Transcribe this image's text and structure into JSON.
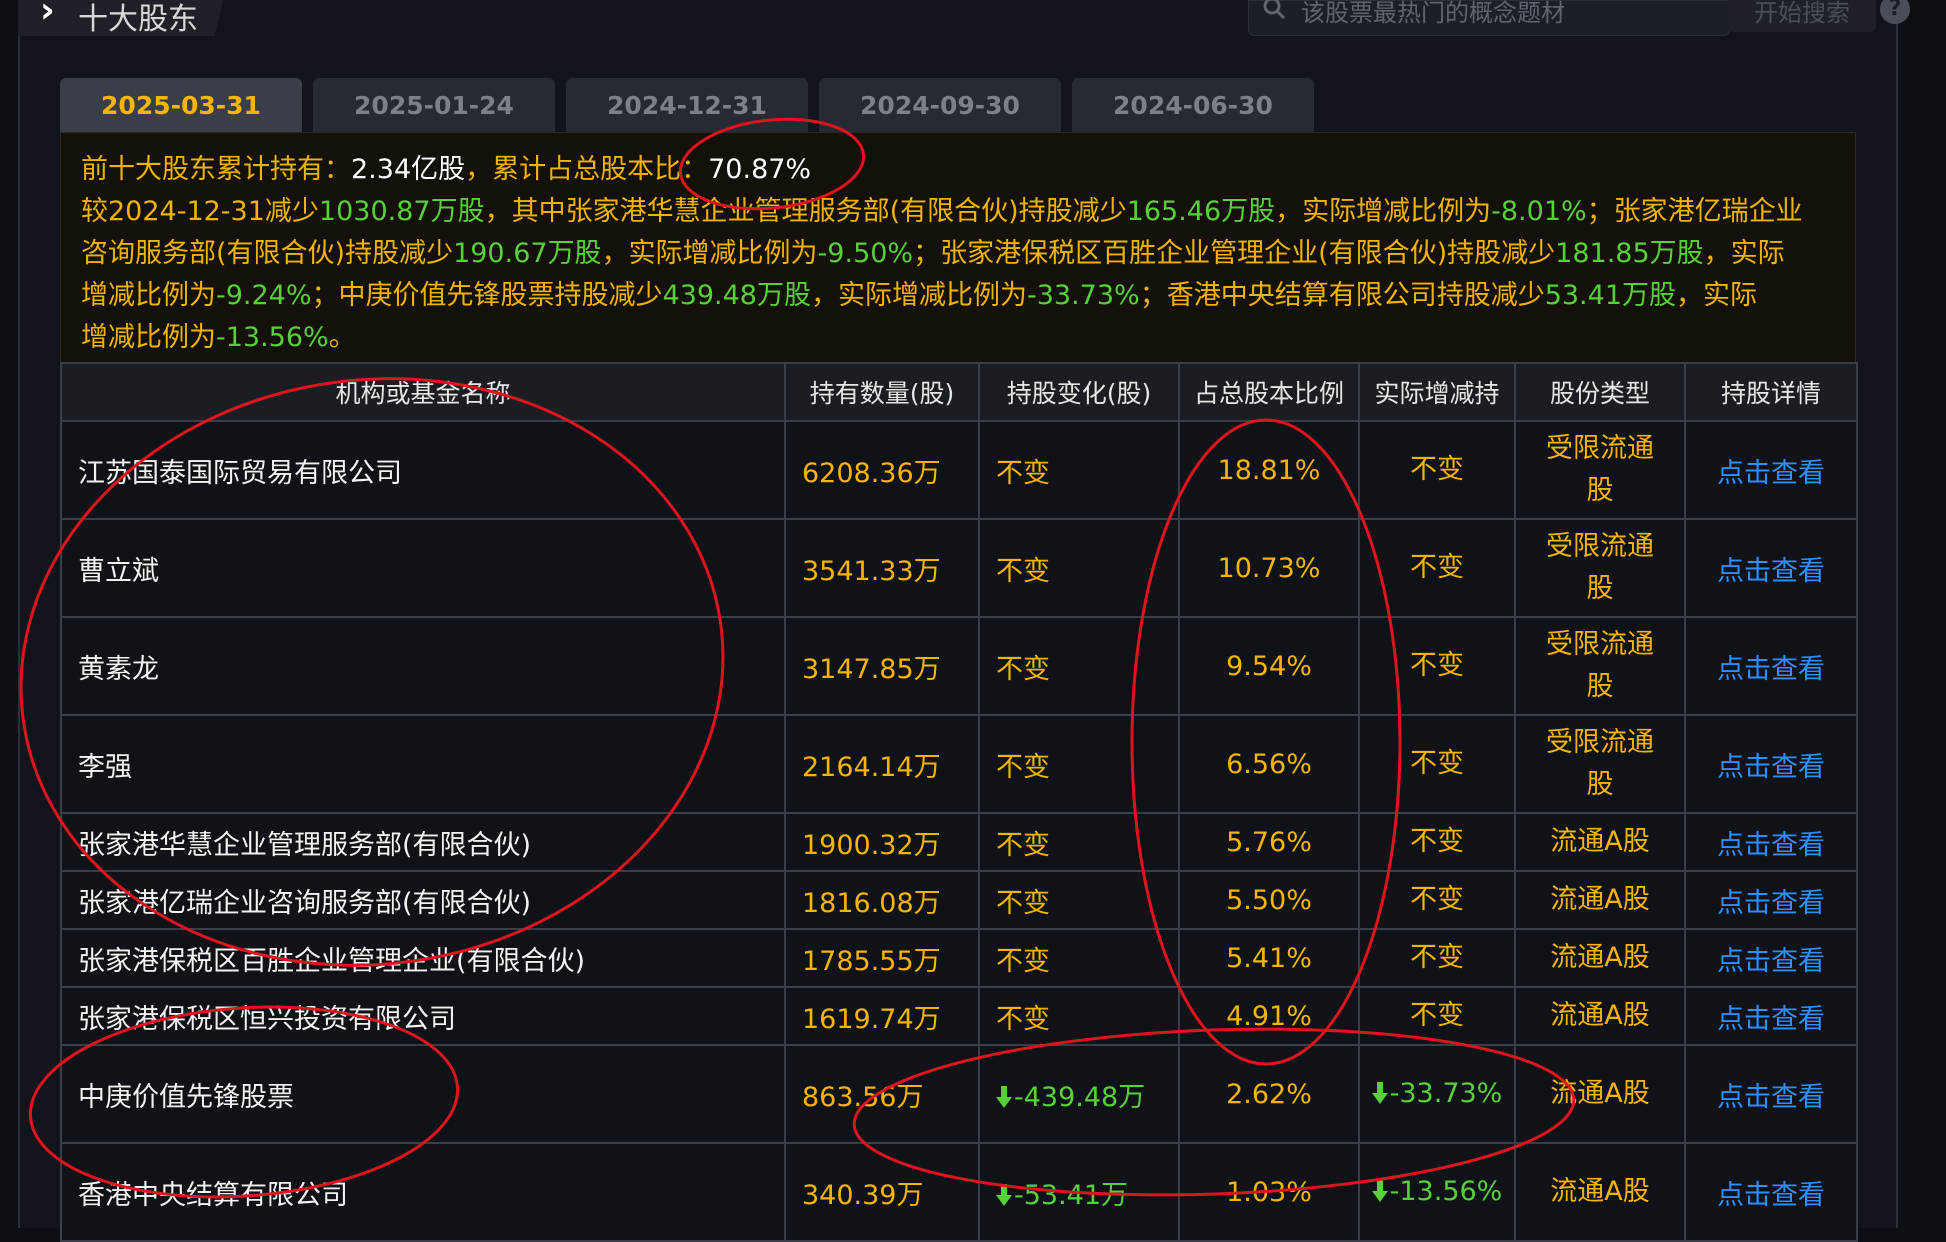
{
  "header": {
    "title": "十大股东",
    "search_placeholder": "该股票最热门的概念题材",
    "search_button": "开始搜索",
    "help": "?"
  },
  "tabs": [
    "2025-03-31",
    "2025-01-24",
    "2024-12-31",
    "2024-09-30",
    "2024-06-30"
  ],
  "summary": {
    "l1_prefix": "前十大股东累计持有：",
    "l1_value": "2.34亿股",
    "l1_mid": "，累计占总股本比：",
    "l1_pct": "70.87%",
    "l2": [
      "较2024-12-31减少",
      "1030.87",
      "万股",
      "，其中张家港华慧企业管理服务部(有限合伙)持股减少",
      "165.46",
      "万股",
      "，实际增减比例为",
      "-8.01%",
      "；张家港亿瑞企业"
    ],
    "l3": [
      "咨询服务部(有限合伙)持股减少",
      "190.67",
      "万股",
      "，实际增减比例为",
      "-9.50%",
      "；张家港保税区百胜企业管理企业(有限合伙)持股减少",
      "181.85",
      "万股",
      "，实际"
    ],
    "l4": [
      "增减比例为",
      "-9.24%",
      "；中庚价值先锋股票持股减少",
      "439.48",
      "万股",
      "，实际增减比例为",
      "-33.73%",
      "；香港中央结算有限公司持股减少",
      "53.41",
      "万股",
      "，实际"
    ],
    "l5": [
      "增减比例为",
      "-13.56%",
      "。"
    ]
  },
  "table": {
    "headers": [
      "机构或基金名称",
      "持有数量(股)",
      "持股变化(股)",
      "占总股本比例",
      "实际增减持",
      "股份类型",
      "持股详情"
    ],
    "rows": [
      {
        "name": "江苏国泰国际贸易有限公司",
        "qty": "6208.36万",
        "change": "不变",
        "pct": "18.81%",
        "actual": "不变",
        "type": "受限流通股",
        "detail": "点击查看"
      },
      {
        "name": "曹立斌",
        "qty": "3541.33万",
        "change": "不变",
        "pct": "10.73%",
        "actual": "不变",
        "type": "受限流通股",
        "detail": "点击查看"
      },
      {
        "name": "黄素龙",
        "qty": "3147.85万",
        "change": "不变",
        "pct": "9.54%",
        "actual": "不变",
        "type": "受限流通股",
        "detail": "点击查看"
      },
      {
        "name": "李强",
        "qty": "2164.14万",
        "change": "不变",
        "pct": "6.56%",
        "actual": "不变",
        "type": "受限流通股",
        "detail": "点击查看"
      },
      {
        "name": "张家港华慧企业管理服务部(有限合伙)",
        "qty": "1900.32万",
        "change": "不变",
        "pct": "5.76%",
        "actual": "不变",
        "type": "流通A股",
        "detail": "点击查看"
      },
      {
        "name": "张家港亿瑞企业咨询服务部(有限合伙)",
        "qty": "1816.08万",
        "change": "不变",
        "pct": "5.50%",
        "actual": "不变",
        "type": "流通A股",
        "detail": "点击查看"
      },
      {
        "name": "张家港保税区百胜企业管理企业(有限合伙)",
        "qty": "1785.55万",
        "change": "不变",
        "pct": "5.41%",
        "actual": "不变",
        "type": "流通A股",
        "detail": "点击查看"
      },
      {
        "name": "张家港保税区恒兴投资有限公司",
        "qty": "1619.74万",
        "change": "不变",
        "pct": "4.91%",
        "actual": "不变",
        "type": "流通A股",
        "detail": "点击查看"
      },
      {
        "name": "中庚价值先锋股票",
        "qty": "863.56万",
        "change": "-439.48万",
        "pct": "2.62%",
        "actual": "-33.73%",
        "type": "流通A股",
        "detail": "点击查看"
      },
      {
        "name": "香港中央结算有限公司",
        "qty": "340.39万",
        "change": "-53.41万",
        "pct": "1.03%",
        "actual": "-13.56%",
        "type": "流通A股",
        "detail": "点击查看"
      }
    ]
  },
  "colors": {
    "accent": "#f7b500",
    "down": "#58d03a",
    "link": "#2f8fff",
    "annotation": "#e0141e"
  }
}
